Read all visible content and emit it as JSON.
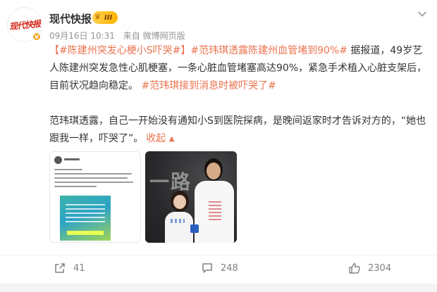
{
  "post": {
    "author": "现代快报",
    "avatar_logo_text": "现代快报",
    "badge_level": "III",
    "time": "09月16日 10:31",
    "source": "来自 微博网页版",
    "text": {
      "tag1": "【#陈建州突发心梗小S吓哭#】",
      "tag2": "#范玮琪透露陈建州血管堵到90%#",
      "p1_rest": " 据报道，49岁艺人陈建州突发急性心肌梗塞，一条心脏血管堵塞高达90%，紧急手术植入心脏支架后，目前状况趋向稳定。",
      "tag3": "#范玮琪接到消息时被吓哭了#",
      "p2": "范玮琪透露，自己一开始没有通知小S到医院探病，是晚间返家时才告诉对方的，“她也跟我一样，吓哭了”。",
      "collapse": "收起"
    }
  },
  "images": {
    "image1_icon": "screenshot-image",
    "image2_icon": "photo-image",
    "photo_text": "一路"
  },
  "actions": {
    "repost_count": "41",
    "comment_count": "248",
    "like_count": "2304"
  },
  "colors": {
    "accent": "#eb7350",
    "text": "#333333",
    "meta": "#939393",
    "badge": "#ffb400",
    "verify": "#f5a623"
  }
}
